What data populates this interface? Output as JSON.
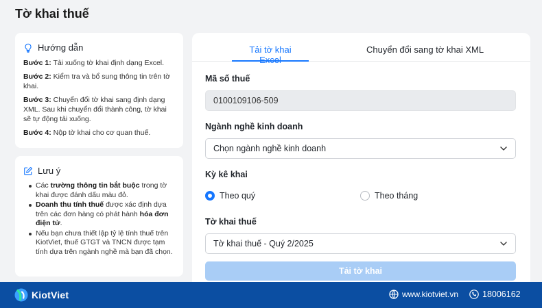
{
  "page": {
    "title": "Tờ khai thuế"
  },
  "guide": {
    "title": "Hướng dẫn",
    "steps": [
      {
        "label": "Bước 1:",
        "text": " Tải xuống tờ khai định dạng Excel."
      },
      {
        "label": "Bước 2:",
        "text": " Kiểm tra và bổ sung thông tin trên tờ khai."
      },
      {
        "label": "Bước 3:",
        "text": " Chuyển đổi tờ khai sang định dạng XML. Sau khi chuyển đổi thành công, tờ khai sẽ tự động tải xuống."
      },
      {
        "label": "Bước 4:",
        "text": " Nộp tờ khai cho cơ quan thuế."
      }
    ]
  },
  "notes": {
    "title": "Lưu ý",
    "item1": {
      "a": "Các ",
      "b": "trường thông tin bắt buộc",
      "c": " trong tờ khai được đánh dấu màu đỏ."
    },
    "item2": {
      "a": "Doanh thu tính thuế",
      "b": " được xác định dựa trên các đơn hàng có phát hành ",
      "c": "hóa đơn điện tử",
      "d": "."
    },
    "item3": {
      "a": "Nếu bạn chưa thiết lập tỷ lệ tính thuế trên KiotViet, thuế GTGT và TNCN được tạm tính dựa trên ngành nghề mà bạn đã chọn."
    }
  },
  "tabs": {
    "excel": "Tải tờ khai Excel",
    "xml": "Chuyển đổi sang tờ khai XML"
  },
  "form": {
    "tax_code_label": "Mã số thuế",
    "tax_code_value": "0100109106-509",
    "industry_label": "Ngành nghề kinh doanh",
    "industry_value": "Chọn ngành nghề kinh doanh",
    "period_label": "Kỳ kê khai",
    "period_quarter": "Theo quý",
    "period_month": "Theo tháng",
    "period_selected": "quarter",
    "declaration_label": "Tờ khai thuế",
    "declaration_value": "Tờ khai thuế - Quý 2/2025",
    "download_button": "Tải tờ khai"
  },
  "footer": {
    "brand": "KiotViet",
    "website": "www.kiotviet.vn",
    "phone": "18006162"
  },
  "colors": {
    "accent": "#1677ff",
    "footer_bg": "#0b4ea2",
    "button_disabled": "#a9cdf6"
  }
}
